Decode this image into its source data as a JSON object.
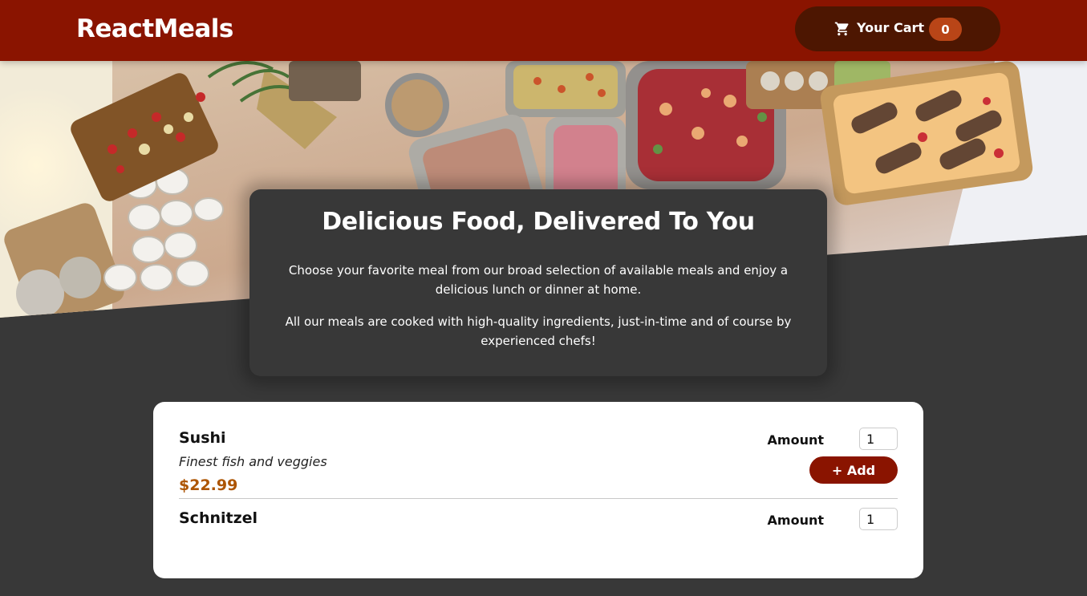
{
  "header": {
    "logo": "ReactMeals",
    "cart_label": "Your Cart",
    "cart_count": "0",
    "cart_icon": "shopping-cart-icon"
  },
  "summary": {
    "title": "Delicious Food, Delivered To You",
    "paragraph1": "Choose your favorite meal from our broad selection of available meals and enjoy a delicious lunch or dinner at home.",
    "paragraph2": "All our meals are cooked with high-quality ingredients, just-in-time and of course by experienced chefs!"
  },
  "meals": [
    {
      "name": "Sushi",
      "description": "Finest fish and veggies",
      "price": "$22.99",
      "amount_label": "Amount",
      "amount_value": "1",
      "add_label": "+ Add"
    },
    {
      "name": "Schnitzel",
      "amount_label": "Amount",
      "amount_value": "1"
    }
  ],
  "colors": {
    "header_bg": "#8a1400",
    "cart_button_bg": "#4d1601",
    "badge_bg": "#b94517",
    "page_bg": "#383838",
    "price": "#ad5502"
  }
}
